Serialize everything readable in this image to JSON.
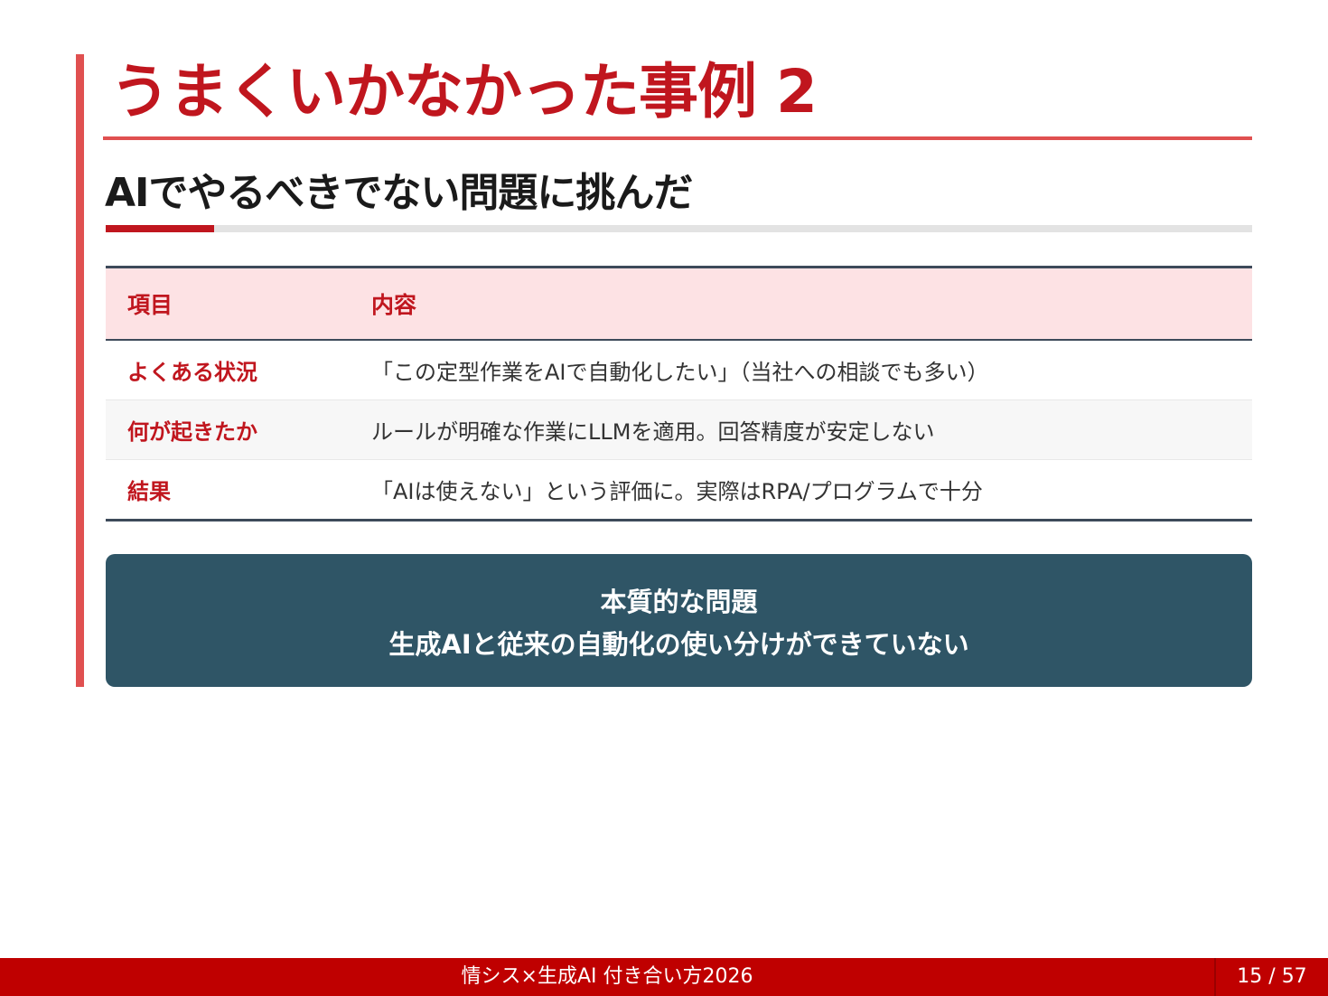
{
  "slide": {
    "title": "うまくいかなかった事例 2",
    "subtitle": "AIでやるべきでない問題に挑んだ"
  },
  "table": {
    "headers": [
      "項目",
      "内容"
    ],
    "rows": [
      [
        "よくある状況",
        "「この定型作業をAIで自動化したい」（当社への相談でも多い）"
      ],
      [
        "何が起きたか",
        "ルールが明確な作業にLLMを適用。回答精度が安定しない"
      ],
      [
        "結果",
        "「AIは使えない」という評価に。実際はRPA/プログラムで十分"
      ]
    ]
  },
  "callout": {
    "heading": "本質的な問題",
    "body": "生成AIと従来の自動化の使い分けができていない"
  },
  "footer": {
    "title": "情シス×生成AI 付き合い方2026",
    "page": "15 / 57"
  },
  "colors": {
    "brand_red": "#c0161e",
    "accent_red": "#e05050",
    "callout_bg": "#2f5566",
    "header_bg": "#fde2e4",
    "footer_bg": "#bf0000"
  }
}
